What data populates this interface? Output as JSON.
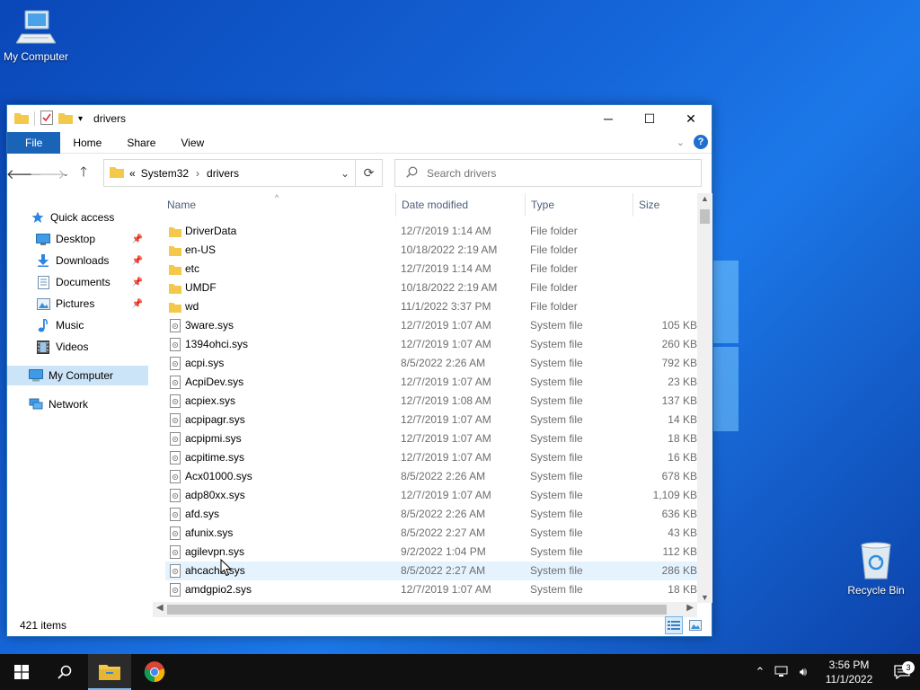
{
  "desktop": {
    "my_computer_label": "My Computer",
    "recycle_bin_label": "Recycle Bin"
  },
  "window": {
    "title": "drivers",
    "controls": {
      "minimize": "─",
      "maximize": "☐",
      "close": "✕"
    }
  },
  "ribbon": {
    "tabs": [
      "File",
      "Home",
      "Share",
      "View"
    ]
  },
  "address": {
    "overflow": "«",
    "crumbs": [
      "System32",
      "drivers"
    ]
  },
  "search": {
    "placeholder": "Search drivers"
  },
  "sidebar": {
    "quick_access": "Quick access",
    "items": [
      {
        "label": "Desktop",
        "icon": "desktop-icon",
        "pinned": true
      },
      {
        "label": "Downloads",
        "icon": "downloads-icon",
        "pinned": true
      },
      {
        "label": "Documents",
        "icon": "documents-icon",
        "pinned": true
      },
      {
        "label": "Pictures",
        "icon": "pictures-icon",
        "pinned": true
      },
      {
        "label": "Music",
        "icon": "music-icon",
        "pinned": false
      },
      {
        "label": "Videos",
        "icon": "videos-icon",
        "pinned": false
      }
    ],
    "my_computer": "My Computer",
    "network": "Network"
  },
  "columns": {
    "name": "Name",
    "date": "Date modified",
    "type": "Type",
    "size": "Size"
  },
  "files": [
    {
      "name": "DriverData",
      "date": "12/7/2019 1:14 AM",
      "type": "File folder",
      "size": "",
      "kind": "folder"
    },
    {
      "name": "en-US",
      "date": "10/18/2022 2:19 AM",
      "type": "File folder",
      "size": "",
      "kind": "folder"
    },
    {
      "name": "etc",
      "date": "12/7/2019 1:14 AM",
      "type": "File folder",
      "size": "",
      "kind": "folder"
    },
    {
      "name": "UMDF",
      "date": "10/18/2022 2:19 AM",
      "type": "File folder",
      "size": "",
      "kind": "folder"
    },
    {
      "name": "wd",
      "date": "11/1/2022 3:37 PM",
      "type": "File folder",
      "size": "",
      "kind": "folder"
    },
    {
      "name": "3ware.sys",
      "date": "12/7/2019 1:07 AM",
      "type": "System file",
      "size": "105 KB",
      "kind": "sys"
    },
    {
      "name": "1394ohci.sys",
      "date": "12/7/2019 1:07 AM",
      "type": "System file",
      "size": "260 KB",
      "kind": "sys"
    },
    {
      "name": "acpi.sys",
      "date": "8/5/2022 2:26 AM",
      "type": "System file",
      "size": "792 KB",
      "kind": "sys"
    },
    {
      "name": "AcpiDev.sys",
      "date": "12/7/2019 1:07 AM",
      "type": "System file",
      "size": "23 KB",
      "kind": "sys"
    },
    {
      "name": "acpiex.sys",
      "date": "12/7/2019 1:08 AM",
      "type": "System file",
      "size": "137 KB",
      "kind": "sys"
    },
    {
      "name": "acpipagr.sys",
      "date": "12/7/2019 1:07 AM",
      "type": "System file",
      "size": "14 KB",
      "kind": "sys"
    },
    {
      "name": "acpipmi.sys",
      "date": "12/7/2019 1:07 AM",
      "type": "System file",
      "size": "18 KB",
      "kind": "sys"
    },
    {
      "name": "acpitime.sys",
      "date": "12/7/2019 1:07 AM",
      "type": "System file",
      "size": "16 KB",
      "kind": "sys"
    },
    {
      "name": "Acx01000.sys",
      "date": "8/5/2022 2:26 AM",
      "type": "System file",
      "size": "678 KB",
      "kind": "sys"
    },
    {
      "name": "adp80xx.sys",
      "date": "12/7/2019 1:07 AM",
      "type": "System file",
      "size": "1,109 KB",
      "kind": "sys"
    },
    {
      "name": "afd.sys",
      "date": "8/5/2022 2:26 AM",
      "type": "System file",
      "size": "636 KB",
      "kind": "sys"
    },
    {
      "name": "afunix.sys",
      "date": "8/5/2022 2:27 AM",
      "type": "System file",
      "size": "43 KB",
      "kind": "sys"
    },
    {
      "name": "agilevpn.sys",
      "date": "9/2/2022 1:04 PM",
      "type": "System file",
      "size": "112 KB",
      "kind": "sys"
    },
    {
      "name": "ahcache.sys",
      "date": "8/5/2022 2:27 AM",
      "type": "System file",
      "size": "286 KB",
      "kind": "sys",
      "hover": true
    },
    {
      "name": "amdgpio2.sys",
      "date": "12/7/2019 1:07 AM",
      "type": "System file",
      "size": "18 KB",
      "kind": "sys"
    }
  ],
  "status": {
    "item_count": "421 items"
  },
  "taskbar": {
    "clock_time": "3:56 PM",
    "clock_date": "11/1/2022",
    "notification_count": "3"
  },
  "colors": {
    "accent": "#1a64b8",
    "folder": "#f4c84a",
    "selection": "#cce4f7",
    "hover": "#e5f3ff"
  }
}
